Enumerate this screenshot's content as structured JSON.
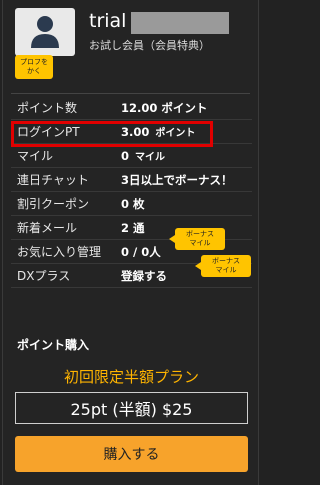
{
  "profile": {
    "username": "trial",
    "member_type": "お試し会員（会員特典）",
    "edit_badge_line1": "プロフを",
    "edit_badge_line2": "かく"
  },
  "stats": {
    "points": {
      "label": "ポイント数",
      "value": "12.00 ポイント"
    },
    "login_pt": {
      "label": "ログインPT",
      "value": "3.00",
      "unit": "ポイント"
    },
    "mile": {
      "label": "マイル",
      "value": "0",
      "unit": "マイル"
    },
    "chat_streak": {
      "label": "連日チャット",
      "value": "3日以上でボーナス！"
    },
    "coupon": {
      "label": "割引クーポン",
      "value": "0 枚"
    },
    "new_mail": {
      "label": "新着メール",
      "value": "2 通"
    },
    "favorites": {
      "label": "お気に入り管理",
      "value": "0 / 0人"
    },
    "dx_plus": {
      "label": "DXプラス",
      "value": "登録する"
    }
  },
  "bubbles": {
    "mail_bonus_line1": "ボーナス",
    "mail_bonus_line2": "マイル",
    "fav_bonus_line1": "ボーナス",
    "fav_bonus_line2": "マイル"
  },
  "purchase": {
    "section_title": "ポイント購入",
    "plan_title": "初回限定半額プラン",
    "plan_option": "25pt (半額) $25",
    "buy_label": "購入する"
  },
  "colors": {
    "accent_yellow": "#ffc400",
    "highlight_red": "#e10000",
    "button_orange": "#f7a32b",
    "plan_orange": "#ffb400"
  }
}
